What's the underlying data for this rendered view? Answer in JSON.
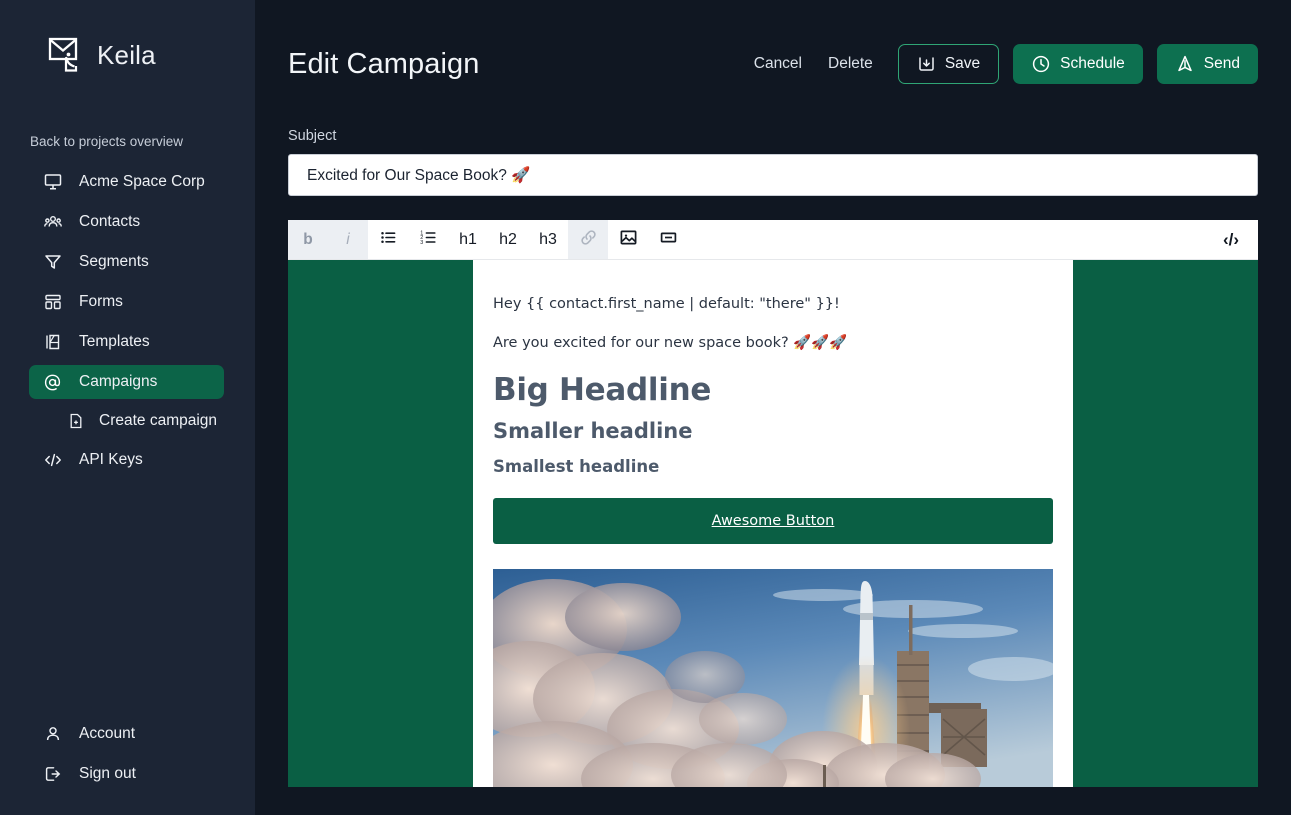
{
  "sidebar": {
    "brand": "Keila",
    "back_link": "Back to projects overview",
    "items": [
      {
        "label": "Acme Space Corp",
        "icon": "monitor-icon"
      },
      {
        "label": "Contacts",
        "icon": "users-icon"
      },
      {
        "label": "Segments",
        "icon": "funnel-icon"
      },
      {
        "label": "Forms",
        "icon": "form-icon"
      },
      {
        "label": "Templates",
        "icon": "template-icon"
      },
      {
        "label": "Campaigns",
        "icon": "at-icon"
      }
    ],
    "sub_item": {
      "label": "Create campaign",
      "icon": "file-plus-icon"
    },
    "api_keys": {
      "label": "API Keys",
      "icon": "code-icon"
    },
    "bottom": [
      {
        "label": "Account",
        "icon": "user-icon"
      },
      {
        "label": "Sign out",
        "icon": "logout-icon"
      }
    ]
  },
  "header": {
    "title": "Edit Campaign",
    "cancel_label": "Cancel",
    "delete_label": "Delete",
    "save_label": "Save",
    "schedule_label": "Schedule",
    "send_label": "Send"
  },
  "subject": {
    "label": "Subject",
    "value": "Excited for Our Space Book? 🚀",
    "placeholder": "Subject"
  },
  "toolbar": {
    "bold": "b",
    "italic": "i",
    "bullet_list": "bullet-list-icon",
    "ordered_list": "ordered-list-icon",
    "h1": "h1",
    "h2": "h2",
    "h3": "h3",
    "link": "link-icon",
    "image": "image-icon",
    "divider": "divider-icon",
    "code": "‹/›"
  },
  "email": {
    "greeting": "Hey {{ contact.first_name | default: \"there\" }}!",
    "intro": "Are you excited for our new space book? 🚀🚀🚀",
    "h1": "Big Headline",
    "h2": "Smaller headline",
    "h3": "Smallest headline",
    "button_label": "Awesome Button",
    "image_alt": "rocket-launch-photo"
  },
  "colors": {
    "sidebar_bg": "#1c2535",
    "main_bg": "#101722",
    "accent_green": "#0d7050",
    "canvas_green": "#0a5f44",
    "outline_green": "#2fa575",
    "heading_slate": "#4d5a6b"
  }
}
